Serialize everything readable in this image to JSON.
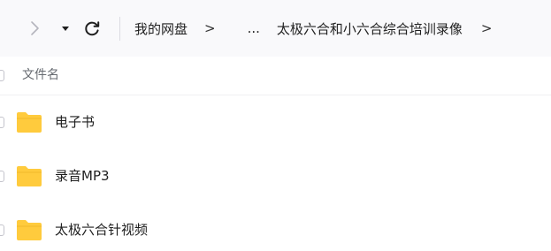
{
  "toolbar": {
    "forward_icon": "chevron-right-icon",
    "history_icon": "caret-down-icon",
    "refresh_icon": "refresh-icon",
    "breadcrumb": {
      "root": "我的网盘",
      "separator": ">",
      "ellipsis": "...",
      "current": "太极六合和小六合综合培训录像"
    }
  },
  "list": {
    "header": {
      "name_column": "文件名"
    },
    "folder_icon": "folder-icon",
    "folder_color": "#ffcb3d",
    "items": [
      {
        "name": "电子书",
        "type": "folder"
      },
      {
        "name": "录音MP3",
        "type": "folder"
      },
      {
        "name": "太极六合针视频",
        "type": "folder"
      }
    ]
  }
}
